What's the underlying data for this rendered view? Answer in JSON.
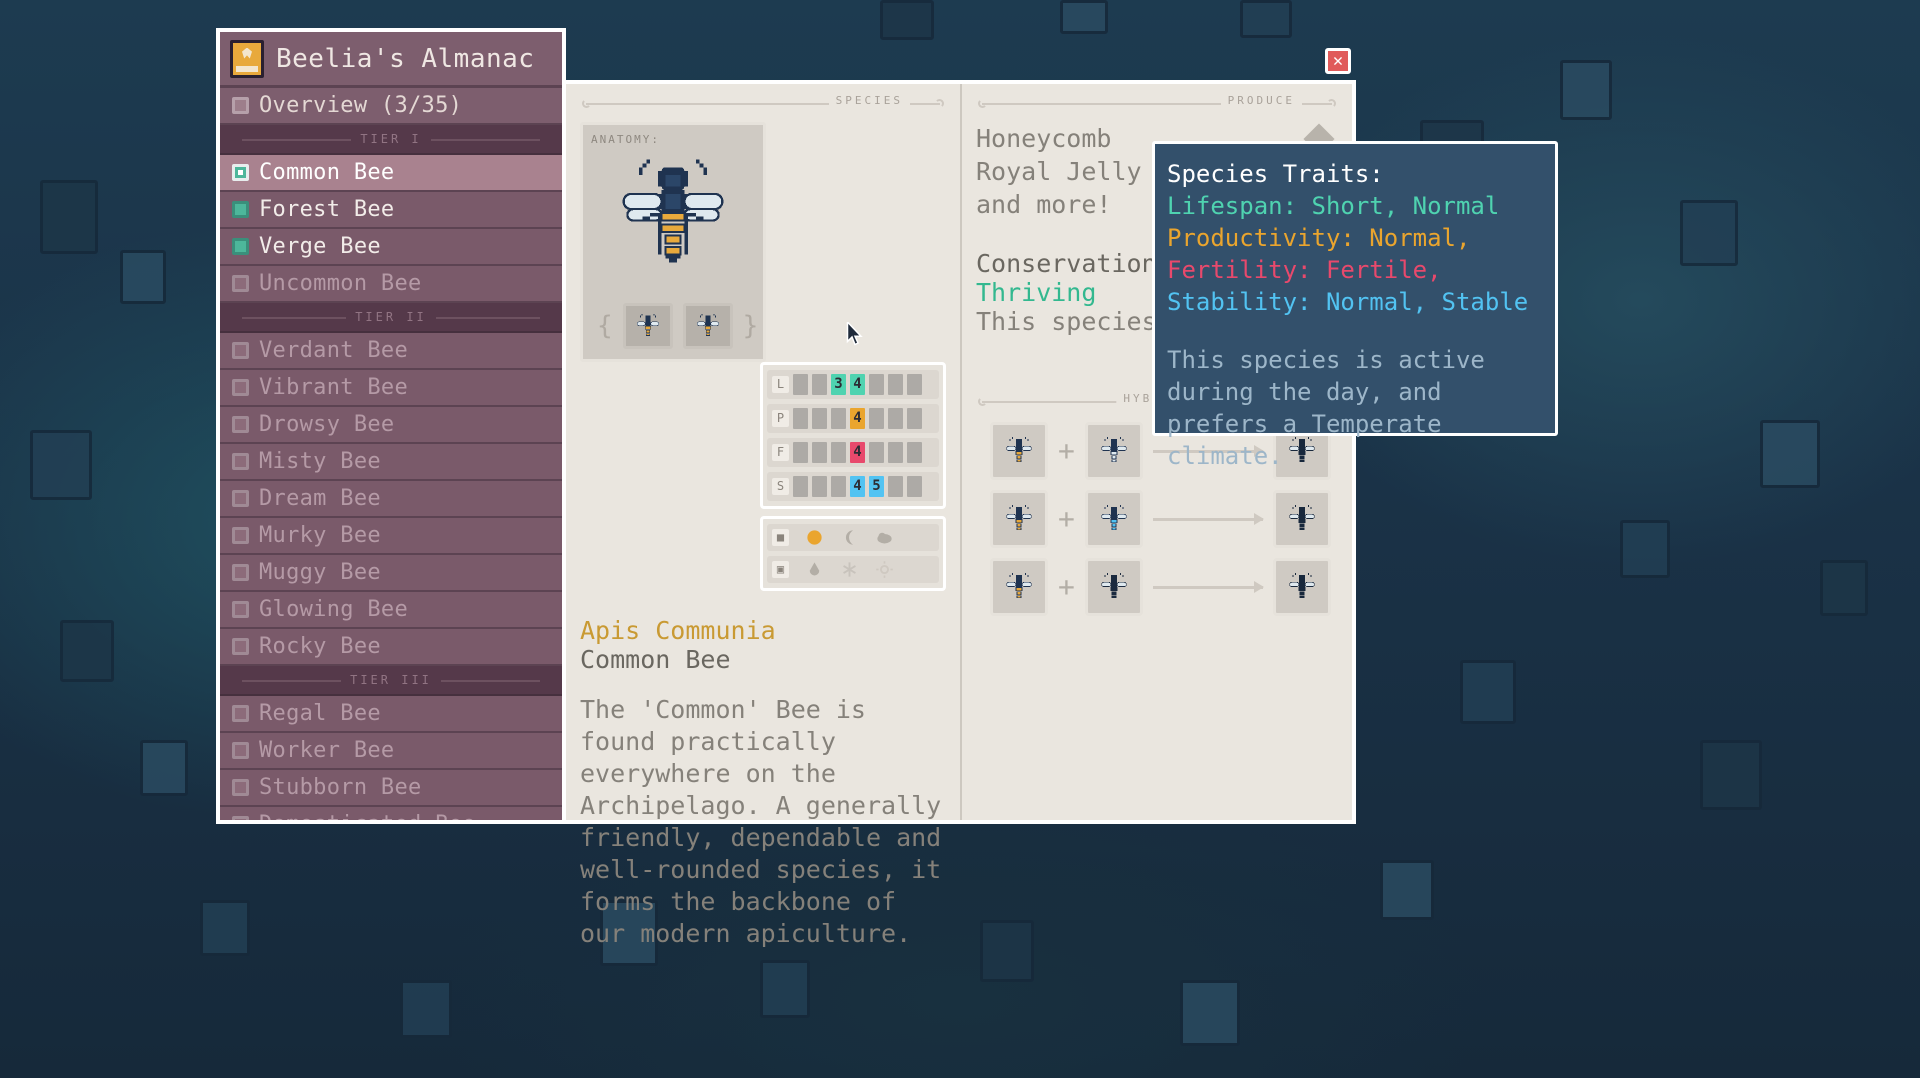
{
  "window": {
    "title": "Beelia's Almanac",
    "book_icon": "book-icon",
    "close_label": "✕"
  },
  "sidebar": {
    "overview": {
      "label": "Overview (3/35)",
      "checkbox": "overview-checkbox"
    },
    "tiers": [
      {
        "label": "TIER I",
        "items": [
          {
            "label": "Common Bee",
            "state": "selected"
          },
          {
            "label": "Forest Bee",
            "state": "unlocked"
          },
          {
            "label": "Verge Bee",
            "state": "unlocked"
          },
          {
            "label": "Uncommon Bee",
            "state": "locked"
          }
        ]
      },
      {
        "label": "TIER II",
        "items": [
          {
            "label": "Verdant Bee",
            "state": "locked"
          },
          {
            "label": "Vibrant Bee",
            "state": "locked"
          },
          {
            "label": "Drowsy Bee",
            "state": "locked"
          },
          {
            "label": "Misty Bee",
            "state": "locked"
          },
          {
            "label": "Dream Bee",
            "state": "locked"
          },
          {
            "label": "Murky Bee",
            "state": "locked"
          },
          {
            "label": "Muggy Bee",
            "state": "locked"
          },
          {
            "label": "Glowing Bee",
            "state": "locked"
          },
          {
            "label": "Rocky Bee",
            "state": "locked"
          }
        ]
      },
      {
        "label": "TIER III",
        "items": [
          {
            "label": "Regal Bee",
            "state": "locked"
          },
          {
            "label": "Worker Bee",
            "state": "locked"
          },
          {
            "label": "Stubborn Bee",
            "state": "locked"
          },
          {
            "label": "Domesticated Bee",
            "state": "locked"
          }
        ]
      }
    ]
  },
  "species_panel": {
    "header": "SPECIES",
    "anatomy_label": "ANATOMY:",
    "latin_name": "Apis Communia",
    "common_name": "Common Bee",
    "description": "The 'Common' Bee is found practically everywhere on the Archipelago. A generally friendly, dependable and well-rounded species, it forms the backbone of our modern apiculture.",
    "stats": [
      {
        "name": "lifespan",
        "icon": "L",
        "slots": 7,
        "filled": [
          3,
          4
        ],
        "labels": [
          "3",
          "4"
        ],
        "color": "#4fd3b0"
      },
      {
        "name": "productivity",
        "icon": "P",
        "slots": 7,
        "filled": [
          4
        ],
        "labels": [
          "4"
        ],
        "color": "#eaa52e"
      },
      {
        "name": "fertility",
        "icon": "F",
        "slots": 7,
        "filled": [
          4
        ],
        "labels": [
          "4"
        ],
        "color": "#e8496c"
      },
      {
        "name": "stability",
        "icon": "S",
        "slots": 7,
        "filled": [
          4,
          5
        ],
        "labels": [
          "4",
          "5"
        ],
        "color": "#52c3f2"
      }
    ],
    "time_row": {
      "icon": "D",
      "options": [
        "sun",
        "moon",
        "cloud"
      ],
      "active": 0
    },
    "climate_row": {
      "icon": "C",
      "options": [
        "drop",
        "snowflake",
        "sunburst"
      ],
      "active": 0
    }
  },
  "produce_panel": {
    "header": "PRODUCE",
    "items": [
      "Honeycomb",
      "Royal Jelly",
      "and more!"
    ],
    "conservation_title": "Conservation Status",
    "conservation_status": "Thriving",
    "conservation_note": "This species is saved!",
    "conservation_badge": "✦✦✦",
    "hybrids_header": "HYBRIDS",
    "hybrid_rows": [
      {
        "parent_a": "common-bee",
        "parent_b": "forest-bee",
        "result": "verdant-bee"
      },
      {
        "parent_a": "common-bee",
        "parent_b": "verge-bee",
        "result": "vibrant-bee"
      },
      {
        "parent_a": "common-bee",
        "parent_b": "dark-bee",
        "result": "drowsy-bee"
      }
    ]
  },
  "tooltip": {
    "title": "Species Traits:",
    "lifespan": "Lifespan: Short, Normal",
    "productivity": "Productivity: Normal,",
    "fertility": "Fertility: Fertile,",
    "stability": "Stability: Normal, Stable",
    "body": "This species is active during the day, and prefers a Temperate climate."
  },
  "colors": {
    "lifespan": "#4fd3b0",
    "productivity": "#eaa52e",
    "fertility": "#e8496c",
    "stability": "#52c3f2",
    "panel_bg": "#eae6df",
    "sidebar_bg": "#7a5a6a",
    "tooltip_bg": "#33506b",
    "accent_gold": "#c99a33"
  }
}
